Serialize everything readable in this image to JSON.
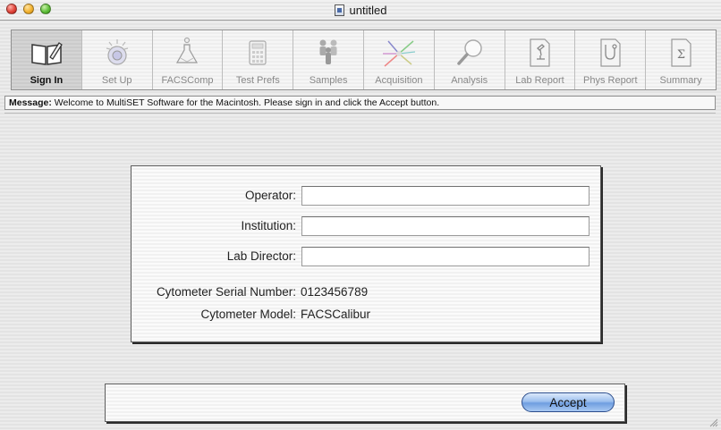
{
  "window": {
    "title": "untitled"
  },
  "toolbar": {
    "items": [
      {
        "label": "Sign In",
        "icon": "book-icon",
        "active": true
      },
      {
        "label": "Set Up",
        "icon": "beads-icon",
        "active": false
      },
      {
        "label": "FACSComp",
        "icon": "flask-icon",
        "active": false
      },
      {
        "label": "Test Prefs",
        "icon": "calculator-icon",
        "active": false
      },
      {
        "label": "Samples",
        "icon": "people-icon",
        "active": false
      },
      {
        "label": "Acquisition",
        "icon": "laser-icon",
        "active": false
      },
      {
        "label": "Analysis",
        "icon": "magnifier-icon",
        "active": false
      },
      {
        "label": "Lab Report",
        "icon": "microscope-doc-icon",
        "active": false
      },
      {
        "label": "Phys Report",
        "icon": "stethoscope-doc-icon",
        "active": false
      },
      {
        "label": "Summary",
        "icon": "sigma-doc-icon",
        "active": false
      }
    ]
  },
  "message": {
    "prefix": "Message:",
    "text": "Welcome to MultiSET Software for the Macintosh.  Please sign in and click the Accept button."
  },
  "form": {
    "operator": {
      "label": "Operator:",
      "value": ""
    },
    "institution": {
      "label": "Institution:",
      "value": ""
    },
    "lab_director": {
      "label": "Lab Director:",
      "value": ""
    },
    "serial": {
      "label": "Cytometer Serial Number:",
      "value": "0123456789"
    },
    "model": {
      "label": "Cytometer Model:",
      "value": "FACSCalibur"
    }
  },
  "actions": {
    "accept_label": "Accept"
  },
  "colors": {
    "accent_button": "#6f9ee0",
    "active_tool": "#d0d0d0"
  }
}
